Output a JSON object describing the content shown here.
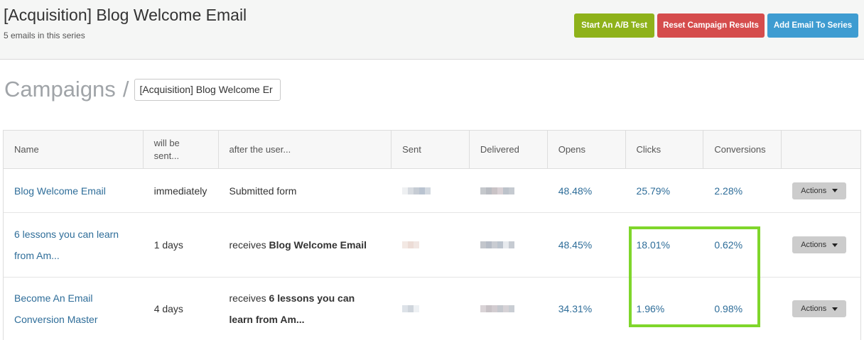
{
  "header": {
    "title": "[Acquisition] Blog Welcome Email",
    "subtitle": "5 emails in this series",
    "buttons": {
      "ab_test": "Start An A/B Test",
      "reset": "Reset Campaign Results",
      "add_email": "Add Email To Series"
    }
  },
  "breadcrumb": {
    "root": "Campaigns",
    "separator": "/",
    "current_value": "[Acquisition] Blog Welcome Er"
  },
  "table": {
    "columns": [
      "Name",
      "will be sent...",
      "after the user...",
      "Sent",
      "Delivered",
      "Opens",
      "Clicks",
      "Conversions",
      ""
    ],
    "rows": [
      {
        "name": "Blog Welcome Email",
        "when": "immediately",
        "after_prefix": "Submitted form",
        "after_bold": "",
        "opens": "48.48%",
        "clicks": "25.79%",
        "conversions": "2.28%",
        "action_label": "Actions"
      },
      {
        "name": "6 lessons you can learn from Am...",
        "when": "1 days",
        "after_prefix": "receives ",
        "after_bold": "Blog Welcome Email",
        "opens": "48.45%",
        "clicks": "18.01%",
        "conversions": "0.62%",
        "action_label": "Actions"
      },
      {
        "name": "Become An Email Conversion Master",
        "when": "4 days",
        "after_prefix": "receives ",
        "after_bold": "6 lessons you can learn from Am...",
        "opens": "34.31%",
        "clicks": "1.96%",
        "conversions": "0.98%",
        "action_label": "Actions"
      }
    ]
  },
  "colors": {
    "ab_button": "#8eb21a",
    "reset_button": "#d54c4c",
    "add_button": "#3e9cd1",
    "link": "#2e6d99",
    "highlight": "#7fd62b"
  }
}
